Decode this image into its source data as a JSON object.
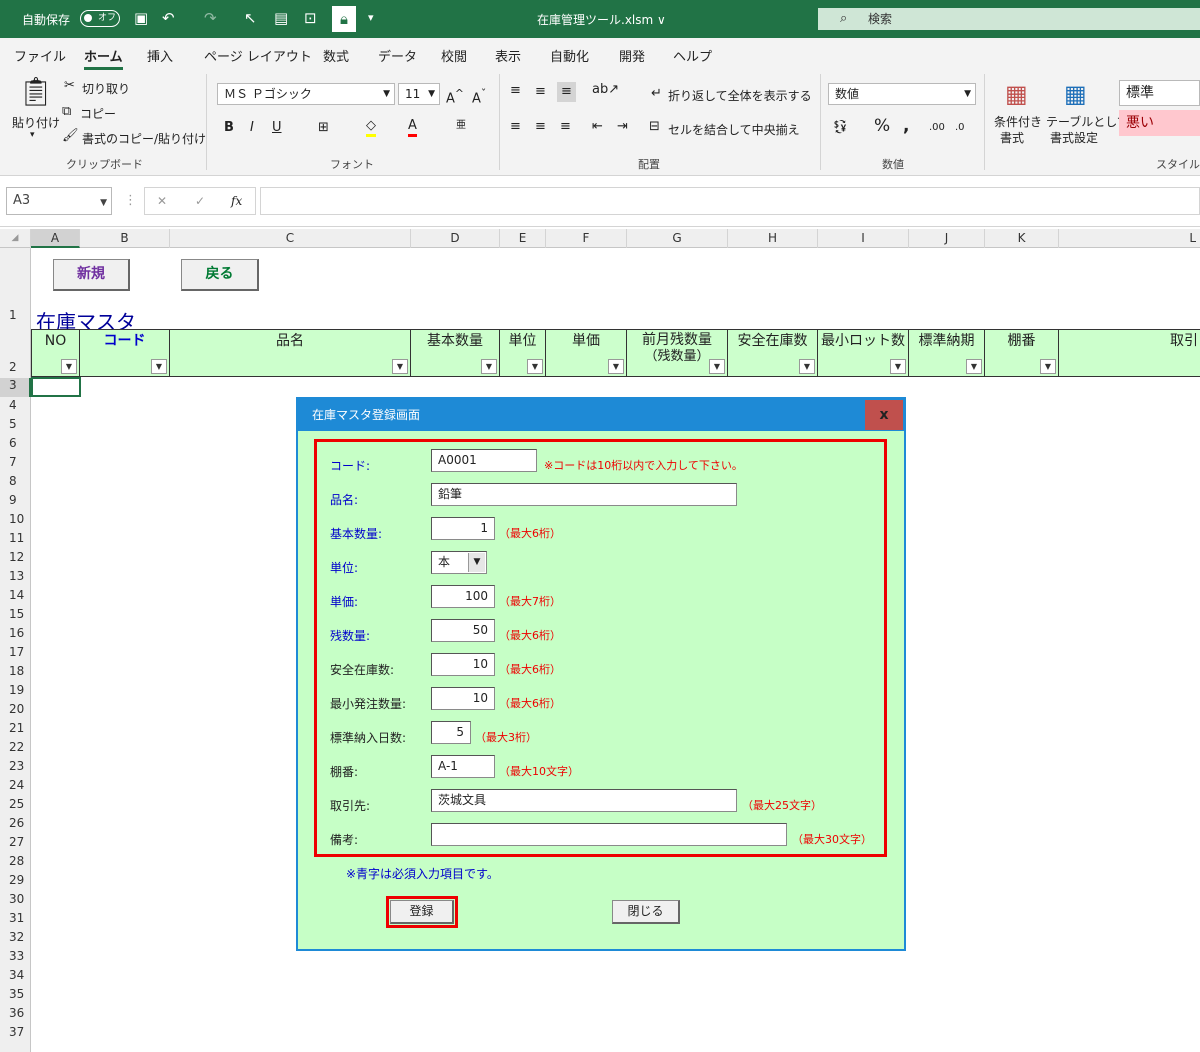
{
  "titlebar": {
    "autosave_label": "自動保存",
    "autosave_state": "オフ",
    "filename": "在庫管理ツール.xlsm ∨",
    "search_placeholder": "検索"
  },
  "tabs": [
    "ファイル",
    "ホーム",
    "挿入",
    "ページ レイアウト",
    "数式",
    "データ",
    "校閲",
    "表示",
    "自動化",
    "開発",
    "ヘルプ"
  ],
  "ribbon": {
    "paste": "貼り付け",
    "cut": "切り取り",
    "copy": "コピー",
    "format_painter": "書式のコピー/貼り付け",
    "clipboard_group": "クリップボード",
    "font_name": "ＭＳ Ｐゴシック",
    "font_size": "11",
    "font_group": "フォント",
    "wrap_text": "折り返して全体を表示する",
    "merge_center": "セルを結合して中央揃え",
    "alignment_group": "配置",
    "number_format": "数値",
    "number_group": "数値",
    "cond_format_1": "条件付き",
    "cond_format_2": "書式",
    "table_format_1": "テーブルとして",
    "table_format_2": "書式設定",
    "style_normal": "標準",
    "style_bad": "悪い",
    "style_group": "スタイル"
  },
  "formula_bar": {
    "name_box": "A3",
    "fx": "fx",
    "cancel": "✕",
    "enter": "✓"
  },
  "columns": [
    "A",
    "B",
    "C",
    "D",
    "E",
    "F",
    "G",
    "H",
    "I",
    "J",
    "K",
    "L"
  ],
  "rows": [
    "1",
    "2",
    "3",
    "4",
    "5",
    "6",
    "7",
    "8",
    "9",
    "10",
    "11",
    "12",
    "13",
    "14",
    "15",
    "16",
    "17",
    "18",
    "19",
    "20",
    "21",
    "22",
    "23",
    "24",
    "25",
    "26",
    "27",
    "28",
    "29",
    "30",
    "31",
    "32",
    "33",
    "34",
    "35",
    "36",
    "37"
  ],
  "sheet": {
    "new_button": "新規",
    "back_button": "戻る",
    "title": "在庫マスタ",
    "headers": [
      "NO",
      "コード",
      "品名",
      "基本数量",
      "単位",
      "単価",
      "前月残数量",
      "（残数量）",
      "安全在庫数",
      "最小ロット数",
      "標準納期",
      "棚番",
      "取引"
    ]
  },
  "dialog": {
    "title": "在庫マスタ登録画面",
    "close": "x",
    "fields": {
      "code_label": "コード:",
      "code_value": "A0001",
      "code_note": "※コードは10桁以内で入力して下さい。",
      "name_label": "品名:",
      "name_value": "鉛筆",
      "base_qty_label": "基本数量:",
      "base_qty_value": "1",
      "base_qty_note": "（最大6桁）",
      "unit_label": "単位:",
      "unit_value": "本",
      "price_label": "単価:",
      "price_value": "100",
      "price_note": "（最大7桁）",
      "remain_label": "残数量:",
      "remain_value": "50",
      "remain_note": "（最大6桁）",
      "safety_label": "安全在庫数:",
      "safety_value": "10",
      "safety_note": "（最大6桁）",
      "min_order_label": "最小発注数量:",
      "min_order_value": "10",
      "min_order_note": "（最大6桁）",
      "lead_label": "標準納入日数:",
      "lead_value": "5",
      "lead_note": "（最大3桁）",
      "shelf_label": "棚番:",
      "shelf_value": "A-1",
      "shelf_note": "（最大10文字）",
      "supplier_label": "取引先:",
      "supplier_value": "茨城文具",
      "supplier_note": "（最大25文字）",
      "remarks_label": "備考:",
      "remarks_value": "",
      "remarks_note": "（最大30文字）"
    },
    "required_note": "※青字は必須入力項目です。",
    "register_button": "登録",
    "close_button": "閉じる"
  },
  "colors": {
    "excel_green": "#217346",
    "header_fill": "#ccffcc",
    "dialog_bg": "#c6ffc6",
    "dialog_title": "#1e8ad6",
    "highlight": "#e00000",
    "required_text": "#0000cc"
  }
}
